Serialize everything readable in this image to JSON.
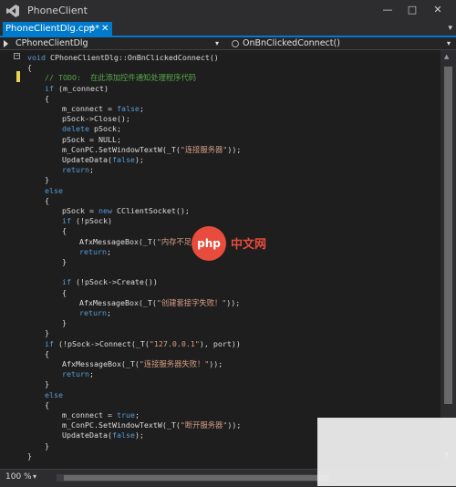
{
  "window": {
    "title": "PhoneClient",
    "controls": [
      "minimize",
      "maximize",
      "close"
    ]
  },
  "tabs": [
    {
      "label": "PhoneClientDlg.cpp*",
      "active": true
    }
  ],
  "navigation": {
    "left_dropdown": "CPhoneClientDlg",
    "right_dropdown": "OnBnClickedConnect()"
  },
  "code_lines": [
    {
      "indent": 0,
      "tokens": [
        {
          "t": "void ",
          "c": "kw"
        },
        {
          "t": "CPhoneClientDlg::OnBnClickedConnect()"
        }
      ]
    },
    {
      "indent": 0,
      "tokens": [
        {
          "t": "{"
        }
      ]
    },
    {
      "indent": 1,
      "tokens": [
        {
          "t": "// TODO:  在此添加控件通知处理程序代码",
          "c": "cm"
        }
      ]
    },
    {
      "indent": 1,
      "tokens": [
        {
          "t": "if ",
          "c": "kw"
        },
        {
          "t": "(m_connect)"
        }
      ]
    },
    {
      "indent": 1,
      "tokens": [
        {
          "t": "{"
        }
      ]
    },
    {
      "indent": 2,
      "tokens": [
        {
          "t": "m_connect = "
        },
        {
          "t": "false",
          "c": "kw"
        },
        {
          "t": ";"
        }
      ]
    },
    {
      "indent": 2,
      "tokens": [
        {
          "t": "pSock->Close();"
        }
      ]
    },
    {
      "indent": 2,
      "tokens": [
        {
          "t": "delete ",
          "c": "kw"
        },
        {
          "t": "pSock;"
        }
      ]
    },
    {
      "indent": 2,
      "tokens": [
        {
          "t": "pSock = NULL;"
        }
      ]
    },
    {
      "indent": 2,
      "tokens": [
        {
          "t": "m_ConPC.SetWindowTextW(_T("
        },
        {
          "t": "\"连接服务器\"",
          "c": "st"
        },
        {
          "t": "));"
        }
      ]
    },
    {
      "indent": 2,
      "tokens": [
        {
          "t": "UpdateData("
        },
        {
          "t": "false",
          "c": "kw"
        },
        {
          "t": ");"
        }
      ]
    },
    {
      "indent": 2,
      "tokens": [
        {
          "t": "return",
          "c": "kw"
        },
        {
          "t": ";"
        }
      ]
    },
    {
      "indent": 1,
      "tokens": [
        {
          "t": "}"
        }
      ]
    },
    {
      "indent": 1,
      "tokens": [
        {
          "t": "else",
          "c": "kw"
        }
      ]
    },
    {
      "indent": 1,
      "tokens": [
        {
          "t": "{"
        }
      ]
    },
    {
      "indent": 2,
      "tokens": [
        {
          "t": "pSock = "
        },
        {
          "t": "new ",
          "c": "kw"
        },
        {
          "t": "CClientSocket();"
        }
      ]
    },
    {
      "indent": 2,
      "tokens": [
        {
          "t": "if ",
          "c": "kw"
        },
        {
          "t": "(!pSock)"
        }
      ]
    },
    {
      "indent": 2,
      "tokens": [
        {
          "t": "{"
        }
      ]
    },
    {
      "indent": 3,
      "tokens": [
        {
          "t": "AfxMessageBox(_T("
        },
        {
          "t": "\"内存不足！\"",
          "c": "st"
        },
        {
          "t": "));"
        }
      ]
    },
    {
      "indent": 3,
      "tokens": [
        {
          "t": "return",
          "c": "kw"
        },
        {
          "t": ";"
        }
      ]
    },
    {
      "indent": 2,
      "tokens": [
        {
          "t": "}"
        }
      ]
    },
    {
      "indent": 2,
      "tokens": []
    },
    {
      "indent": 2,
      "tokens": [
        {
          "t": "if ",
          "c": "kw"
        },
        {
          "t": "(!pSock->Create())"
        }
      ]
    },
    {
      "indent": 2,
      "tokens": [
        {
          "t": "{"
        }
      ]
    },
    {
      "indent": 3,
      "tokens": [
        {
          "t": "AfxMessageBox(_T("
        },
        {
          "t": "\"创建套接字失败！\"",
          "c": "st"
        },
        {
          "t": "));"
        }
      ]
    },
    {
      "indent": 3,
      "tokens": [
        {
          "t": "return",
          "c": "kw"
        },
        {
          "t": ";"
        }
      ]
    },
    {
      "indent": 2,
      "tokens": [
        {
          "t": "}"
        }
      ]
    },
    {
      "indent": 1,
      "tokens": [
        {
          "t": "}"
        }
      ]
    },
    {
      "indent": 1,
      "tokens": [
        {
          "t": "if ",
          "c": "kw"
        },
        {
          "t": "(!pSock->Connect(_T("
        },
        {
          "t": "\"127.0.0.1\"",
          "c": "st"
        },
        {
          "t": "), port))"
        }
      ]
    },
    {
      "indent": 1,
      "tokens": [
        {
          "t": "{"
        }
      ]
    },
    {
      "indent": 2,
      "tokens": [
        {
          "t": "AfxMessageBox(_T("
        },
        {
          "t": "\"连接服务器失败！\"",
          "c": "st"
        },
        {
          "t": "));"
        }
      ]
    },
    {
      "indent": 2,
      "tokens": [
        {
          "t": "return",
          "c": "kw"
        },
        {
          "t": ";"
        }
      ]
    },
    {
      "indent": 1,
      "tokens": [
        {
          "t": "}"
        }
      ]
    },
    {
      "indent": 1,
      "tokens": [
        {
          "t": "else",
          "c": "kw"
        }
      ]
    },
    {
      "indent": 1,
      "tokens": [
        {
          "t": "{"
        }
      ]
    },
    {
      "indent": 2,
      "tokens": [
        {
          "t": "m_connect = "
        },
        {
          "t": "true",
          "c": "kw"
        },
        {
          "t": ";"
        }
      ]
    },
    {
      "indent": 2,
      "tokens": [
        {
          "t": "m_ConPC.SetWindowTextW(_T("
        },
        {
          "t": "\"断开服务器\"",
          "c": "st"
        },
        {
          "t": "));"
        }
      ]
    },
    {
      "indent": 2,
      "tokens": [
        {
          "t": "UpdateData("
        },
        {
          "t": "false",
          "c": "kw"
        },
        {
          "t": ");"
        }
      ]
    },
    {
      "indent": 1,
      "tokens": [
        {
          "t": "}"
        }
      ]
    },
    {
      "indent": 0,
      "tokens": [
        {
          "t": "}"
        }
      ]
    }
  ],
  "status": {
    "zoom": "100 %"
  },
  "watermark": {
    "badge": "php",
    "text": "中文网"
  },
  "colors": {
    "accent": "#007acc",
    "keyword": "#569cd6",
    "comment": "#57a64a",
    "string": "#d69d85"
  }
}
